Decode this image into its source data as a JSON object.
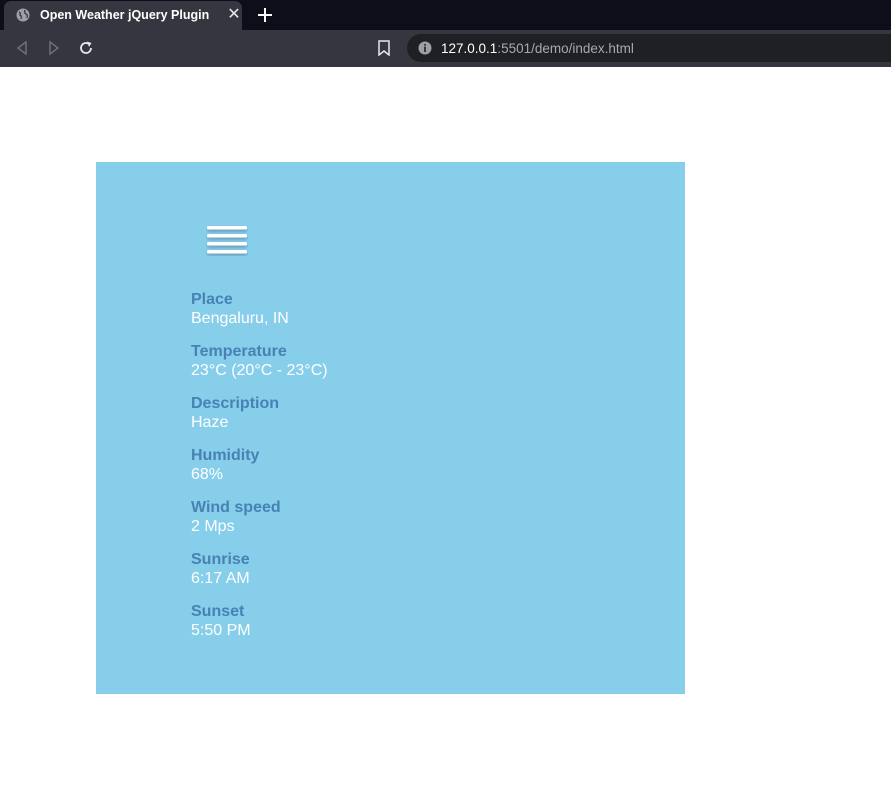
{
  "browser": {
    "tab_title": "Open Weather jQuery Plugin",
    "tab_close": "✕",
    "url_host": "127.0.0.1",
    "url_path": ":5501/demo/index.html"
  },
  "weather": {
    "icon": "haze-icon",
    "fields": [
      {
        "label": "Place",
        "value": "Bengaluru, IN"
      },
      {
        "label": "Temperature",
        "value": "23°C (20°C - 23°C)"
      },
      {
        "label": "Description",
        "value": "Haze"
      },
      {
        "label": "Humidity",
        "value": "68%"
      },
      {
        "label": "Wind speed",
        "value": "2 Mps"
      },
      {
        "label": "Sunrise",
        "value": "6:17 AM"
      },
      {
        "label": "Sunset",
        "value": "5:50 PM"
      }
    ]
  },
  "colors": {
    "widget_bg": "#87ceeb",
    "label": "#4682b4",
    "value": "#ffffff"
  }
}
